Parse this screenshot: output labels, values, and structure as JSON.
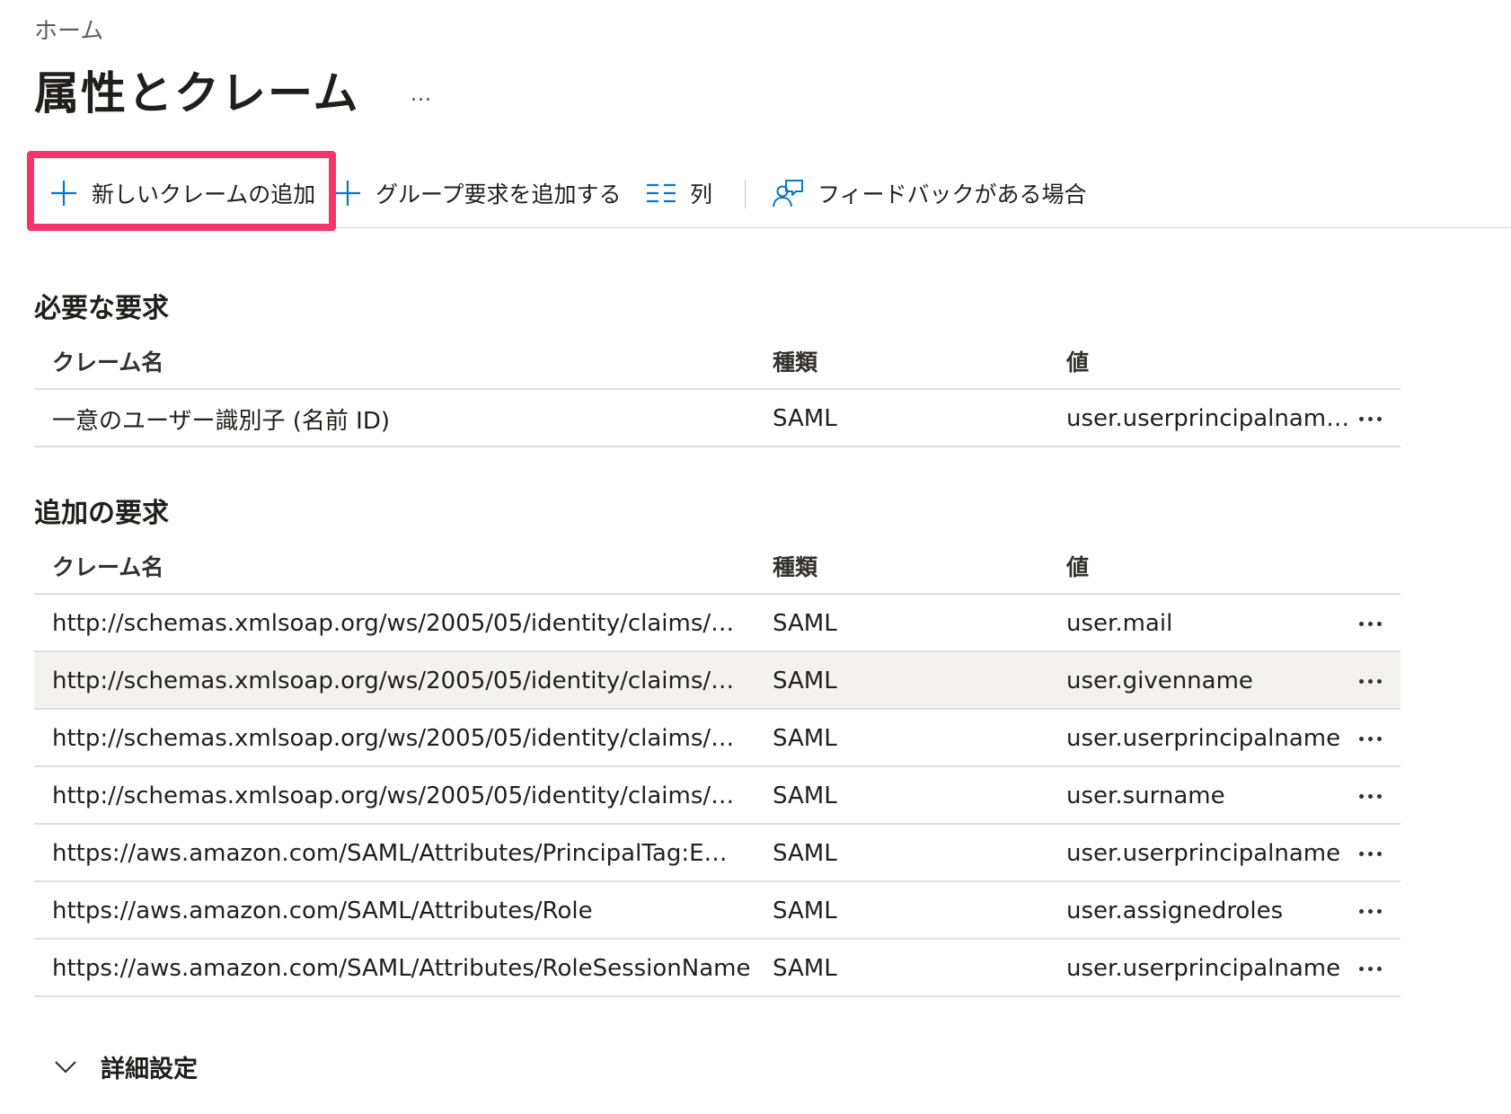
{
  "breadcrumb": "ホーム",
  "page": {
    "title": "属性とクレーム",
    "more": "…"
  },
  "toolbar": {
    "add_claim": "新しいクレームの追加",
    "add_group": "グループ要求を追加する",
    "columns": "列",
    "feedback": "フィードバックがある場合",
    "icons": {
      "add": "plus-icon",
      "columns": "columns-icon",
      "feedback": "feedback-person-icon"
    },
    "highlight_color": "#f4356b",
    "accent_color": "#0078d4"
  },
  "required": {
    "title": "必要な要求",
    "headers": {
      "name": "クレーム名",
      "type": "種類",
      "value": "値"
    },
    "rows": [
      {
        "name": "一意のユーザー識別子 (名前 ID)",
        "type": "SAML",
        "value": "user.userprincipalnam…"
      }
    ]
  },
  "additional": {
    "title": "追加の要求",
    "headers": {
      "name": "クレーム名",
      "type": "種類",
      "value": "値"
    },
    "rows": [
      {
        "name": "http://schemas.xmlsoap.org/ws/2005/05/identity/claims/…",
        "type": "SAML",
        "value": "user.mail"
      },
      {
        "name": "http://schemas.xmlsoap.org/ws/2005/05/identity/claims/…",
        "type": "SAML",
        "value": "user.givenname"
      },
      {
        "name": "http://schemas.xmlsoap.org/ws/2005/05/identity/claims/…",
        "type": "SAML",
        "value": "user.userprincipalname"
      },
      {
        "name": "http://schemas.xmlsoap.org/ws/2005/05/identity/claims/…",
        "type": "SAML",
        "value": "user.surname"
      },
      {
        "name": "https://aws.amazon.com/SAML/Attributes/PrincipalTag:E…",
        "type": "SAML",
        "value": "user.userprincipalname"
      },
      {
        "name": "https://aws.amazon.com/SAML/Attributes/Role",
        "type": "SAML",
        "value": "user.assignedroles"
      },
      {
        "name": "https://aws.amazon.com/SAML/Attributes/RoleSessionName",
        "type": "SAML",
        "value": "user.userprincipalname"
      }
    ]
  },
  "advanced": {
    "label": "詳細設定",
    "icon": "chevron-down-icon"
  }
}
